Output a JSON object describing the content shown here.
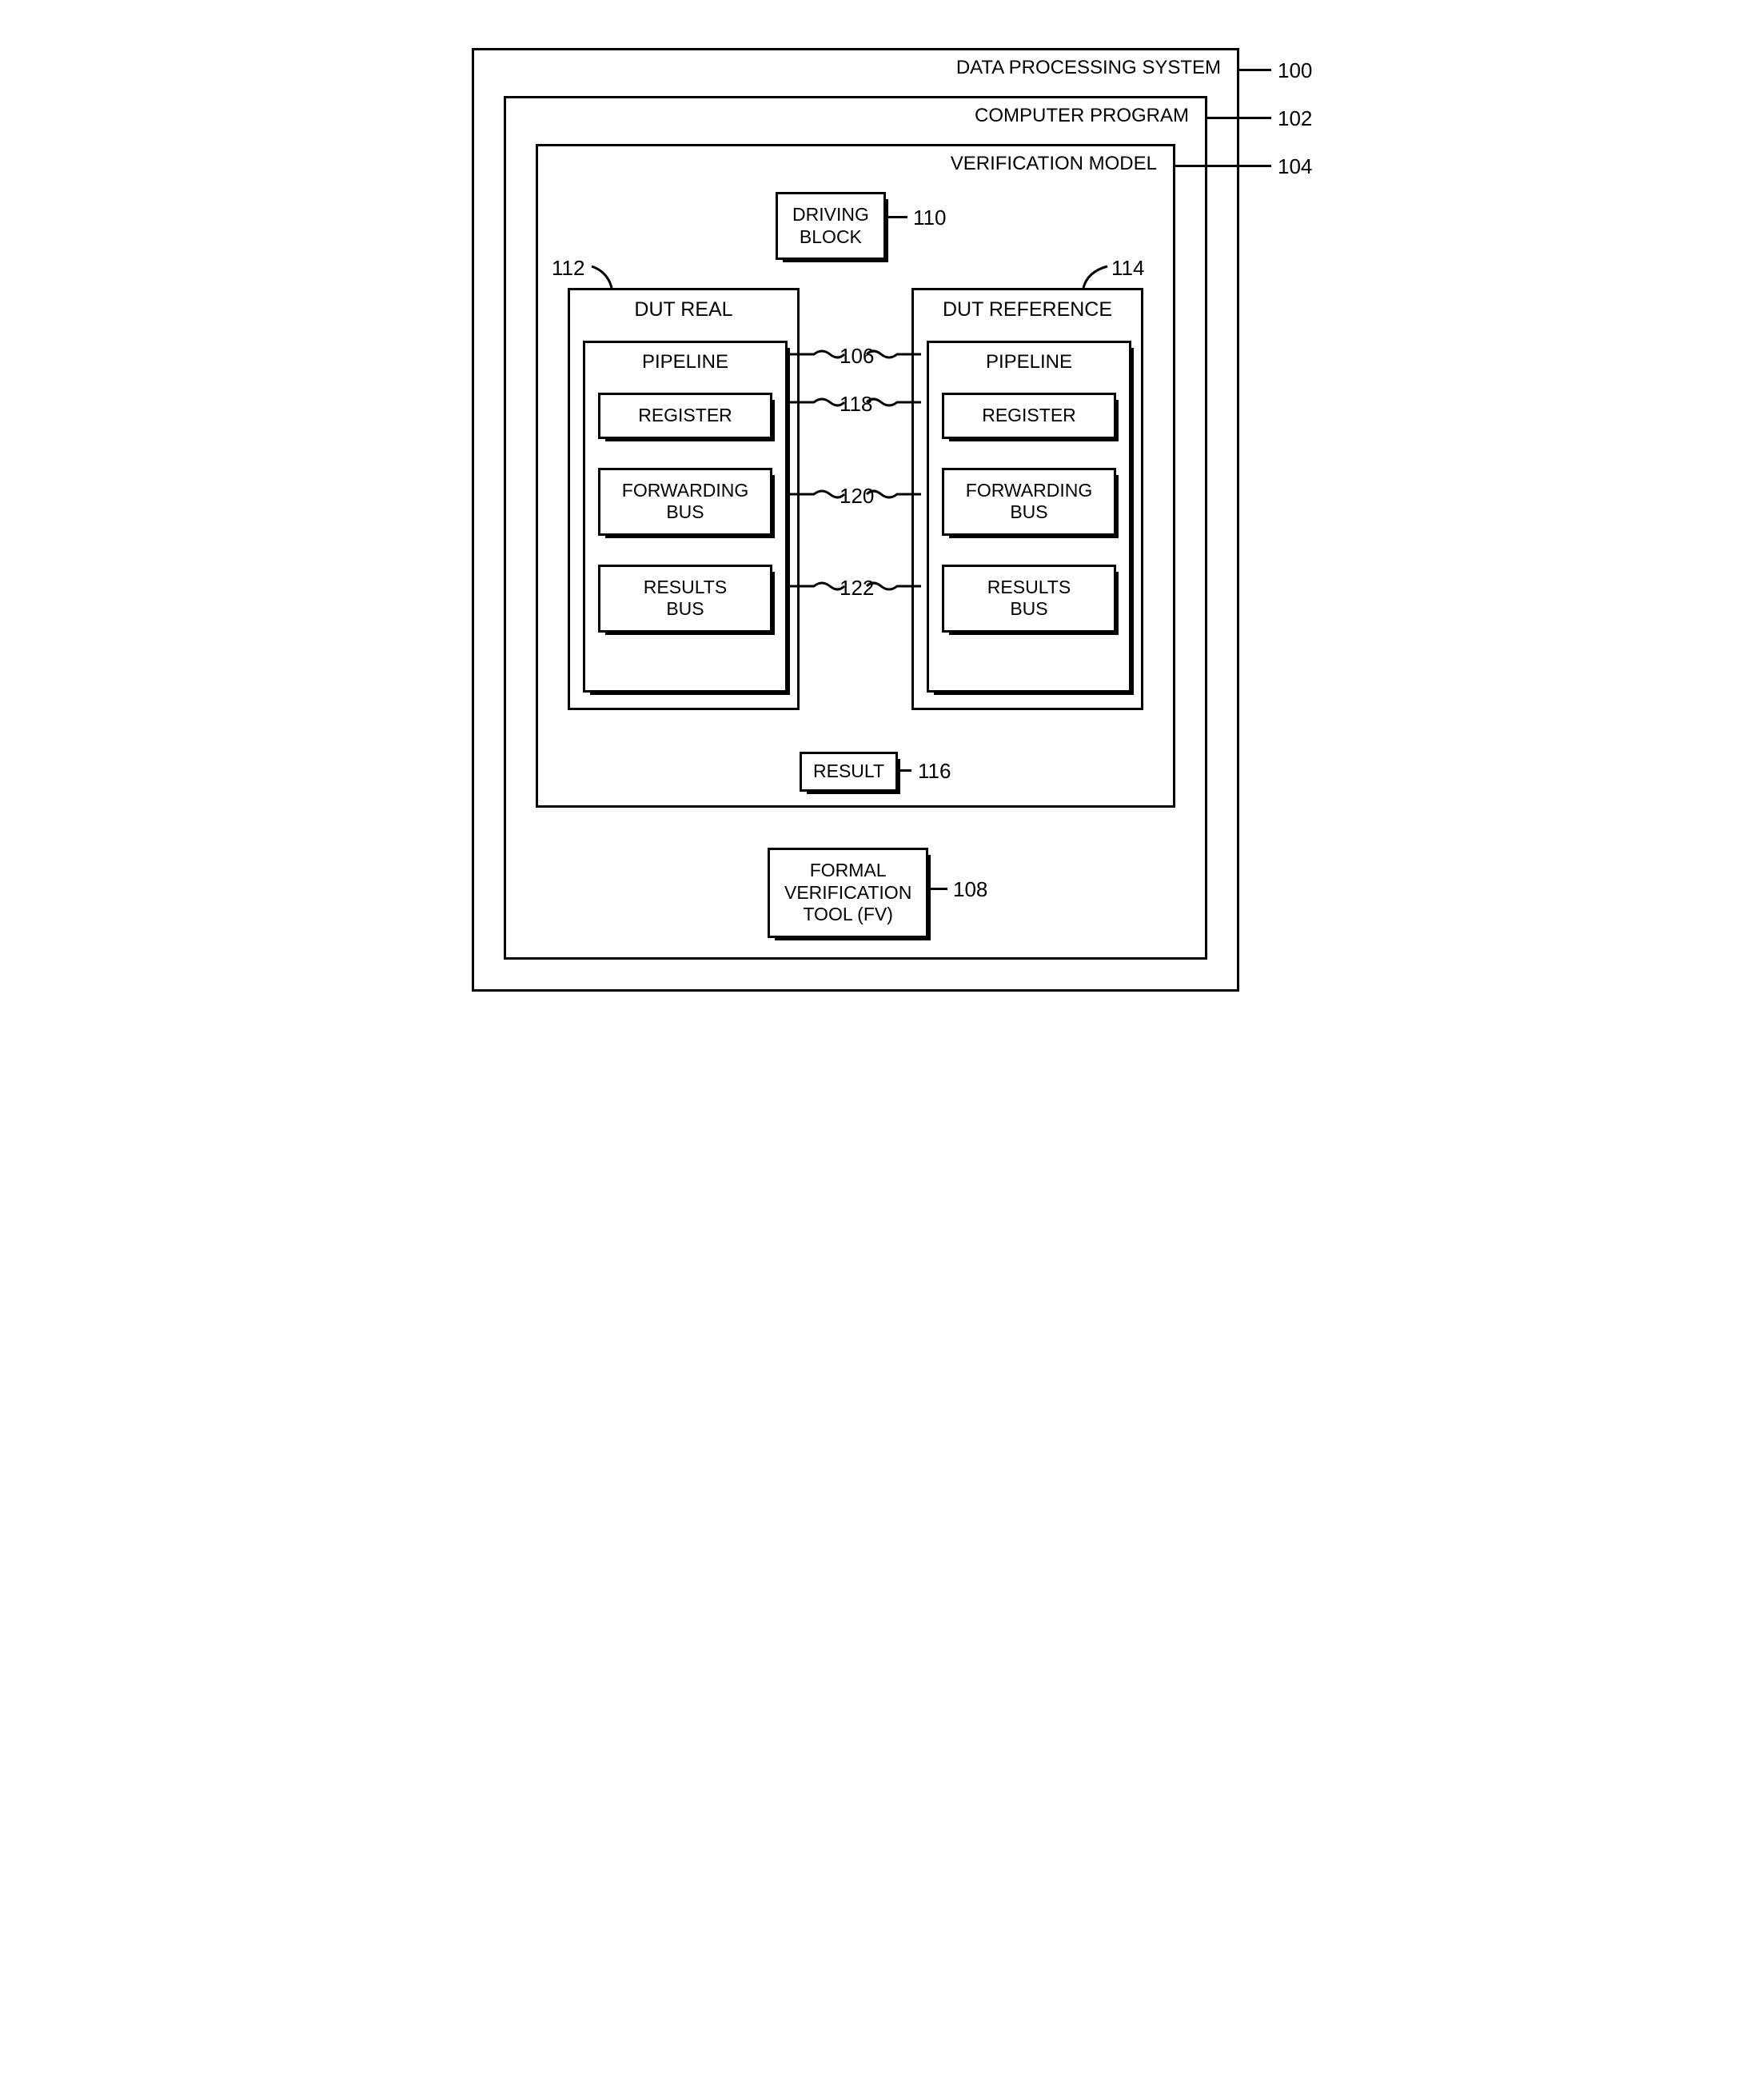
{
  "labels": {
    "system": "DATA PROCESSING SYSTEM",
    "program": "COMPUTER PROGRAM",
    "model": "VERIFICATION MODEL",
    "driving": "DRIVING\nBLOCK",
    "dut_real": "DUT REAL",
    "dut_ref": "DUT REFERENCE",
    "pipeline": "PIPELINE",
    "register": "REGISTER",
    "forwarding": "FORWARDING\nBUS",
    "results": "RESULTS\nBUS",
    "result": "RESULT",
    "formal": "FORMAL\nVERIFICATION\nTOOL (FV)"
  },
  "refs": {
    "system": "100",
    "program": "102",
    "model": "104",
    "pipeline": "106",
    "formal": "108",
    "driving": "110",
    "dut_real": "112",
    "dut_ref": "114",
    "result": "116",
    "register": "118",
    "forwarding": "120",
    "results": "122"
  }
}
